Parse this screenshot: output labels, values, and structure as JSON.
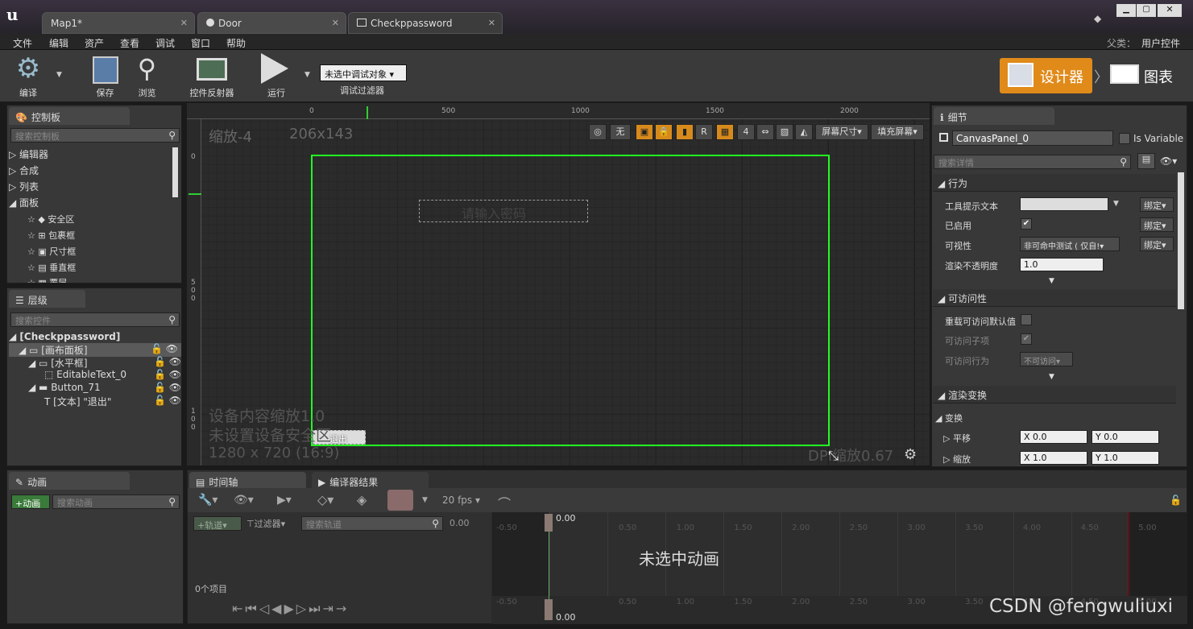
{
  "tabs": [
    {
      "label": "Map1*"
    },
    {
      "label": "Door"
    },
    {
      "label": "Checkppassword"
    }
  ],
  "menu": [
    "文件",
    "编辑",
    "资产",
    "查看",
    "调试",
    "窗口",
    "帮助"
  ],
  "parent": {
    "label": "父类：",
    "value": "用户控件"
  },
  "toolbar": {
    "compile": "编译",
    "save": "保存",
    "browse": "浏览",
    "reflector": "控件反射器",
    "run": "运行",
    "debug_select": "未选中调试对象",
    "debug_filter": "调试过滤器",
    "designer": "设计器",
    "graph": "图表"
  },
  "palette": {
    "tab": "控制板",
    "search_placeholder": "搜索控制板",
    "categories": [
      "编辑器",
      "合成",
      "列表",
      "面板"
    ],
    "items": [
      "安全区",
      "包裹框",
      "尺寸框",
      "垂直框",
      "覆层"
    ]
  },
  "hierarchy": {
    "tab": "层级",
    "search_placeholder": "搜索控件",
    "root": "[Checkppassword]",
    "nodes": [
      "[画布面板]",
      "[水平框]",
      "EditableText_0",
      "Button_71",
      "[文本] \"退出\""
    ]
  },
  "canvas": {
    "zoom": "缩放-4",
    "size": "206x143",
    "btn_none": "无",
    "btn_r": "R",
    "btn_4": "4",
    "screen_size": "屏幕尺寸",
    "fill_screen": "填充屏幕",
    "placeholder": "请输入密码",
    "exit_button": "退出",
    "device_scale": "设备内容缩放1.0",
    "safe_zone": "未设置设备安全区",
    "resolution": "1280 x 720 (16:9)",
    "dpi": "DPI缩放0.67",
    "ruler_top": [
      "0",
      "500",
      "1000",
      "1500",
      "2000"
    ],
    "ruler_left": [
      "0",
      "500",
      "100"
    ]
  },
  "details": {
    "tab": "细节",
    "name": "CanvasPanel_0",
    "is_variable": "Is Variable",
    "search_placeholder": "搜索详情",
    "section_behavior": "行为",
    "tooltip": "工具提示文本",
    "enabled": "已启用",
    "visibility": "可视性",
    "visibility_value": "非可命中测试 ( 仅自!",
    "opacity": "渲染不透明度",
    "opacity_value": "1.0",
    "bind": "绑定",
    "section_access": "可访问性",
    "override_access": "重载可访问默认值",
    "access_children": "可访问子项",
    "access_behavior": "可访问行为",
    "access_behavior_value": "不可访问",
    "section_render": "渲染变换",
    "transform": "变换",
    "translation": "平移",
    "scale": "缩放",
    "tx": "X 0.0",
    "ty": "Y 0.0",
    "sx": "X 1.0",
    "sy": "Y 1.0"
  },
  "animation": {
    "tab": "动画",
    "add": "+动画",
    "search_placeholder": "搜索动画"
  },
  "timeline": {
    "tab": "时间轴",
    "compiler_tab": "编译器结果",
    "fps": "20 fps",
    "track": "+轨道",
    "filter": "过滤器",
    "search_placeholder": "搜索轨道",
    "time_value": "0.00",
    "cursor_time": "0.00",
    "items_count": "0个项目",
    "no_anim": "未选中动画",
    "ticks": [
      "-0.50",
      "0.50",
      "1.00",
      "1.50",
      "2.00",
      "2.50",
      "3.00",
      "3.50",
      "4.00",
      "4.50",
      "5.00"
    ]
  },
  "watermark": "CSDN @fengwuliuxi"
}
